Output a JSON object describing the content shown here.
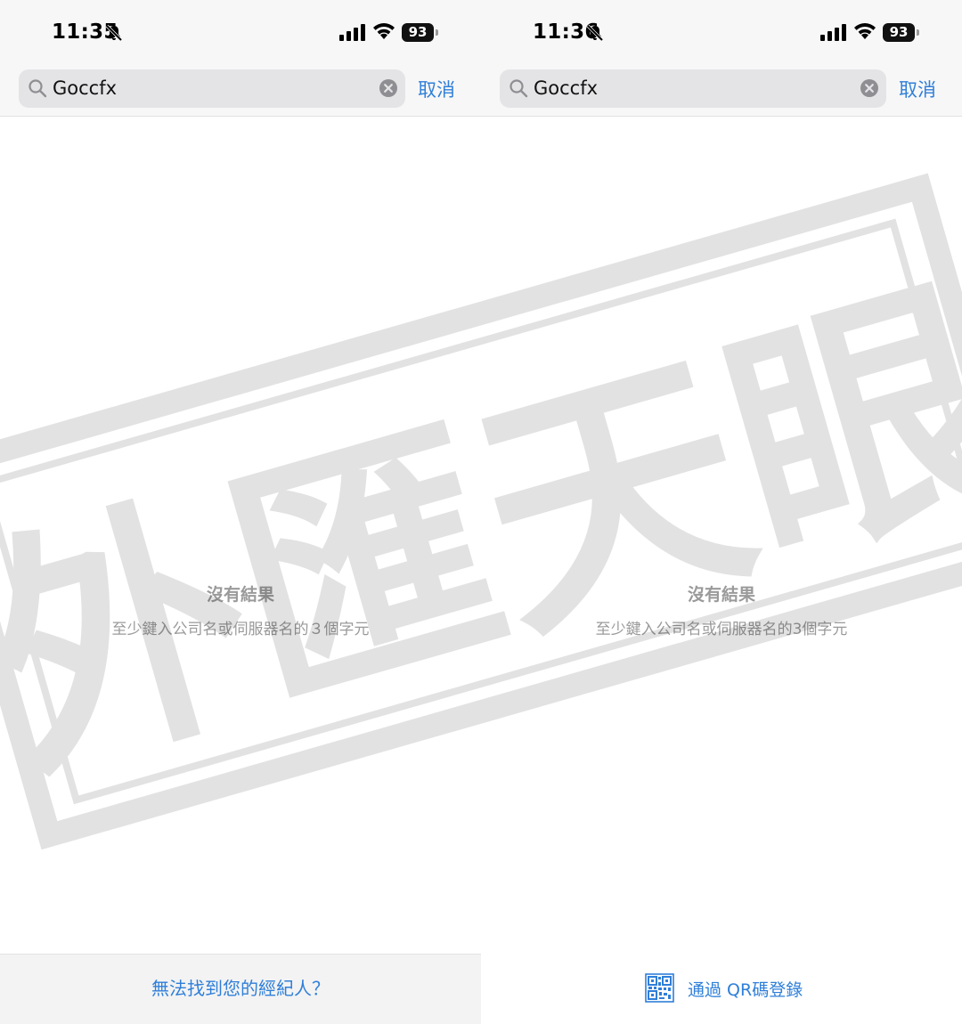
{
  "screens": [
    {
      "status": {
        "time": "11:35",
        "battery": "93"
      },
      "search": {
        "query": "Goccfx",
        "cancel_label": "取消"
      },
      "empty": {
        "title": "沒有結果",
        "hint": "至少鍵入公司名或伺服器名的３個字元"
      },
      "footer": {
        "link_label": "無法找到您的經紀人？"
      }
    },
    {
      "status": {
        "time": "11:36",
        "battery": "93"
      },
      "search": {
        "query": "Goccfx",
        "cancel_label": "取消"
      },
      "empty": {
        "title": "沒有結果",
        "hint": "至少鍵入公司名或伺服器名的3個字元"
      },
      "footer": {
        "qr_label": "通過 QR碼登錄"
      }
    }
  ],
  "watermark": {
    "text": "外匯天眼"
  },
  "colors": {
    "accent": "#2f7fd9",
    "muted": "#9a9a9a",
    "searchbar": "#e4e4e6",
    "topbar": "#f7f7f7"
  }
}
